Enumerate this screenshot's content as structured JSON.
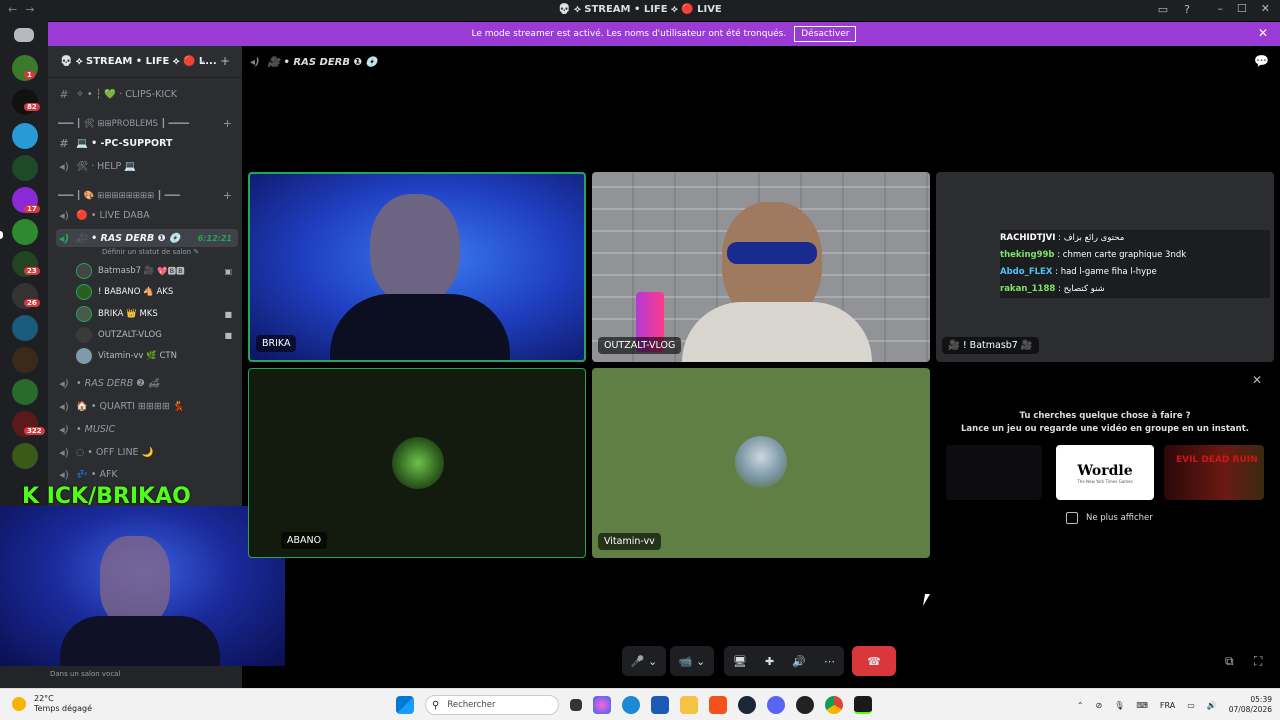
{
  "window": {
    "title": "💀 ⟡ STREAM • LIFE ⟡ 🔴 LIVE",
    "nav_back": "←",
    "nav_forward": "→",
    "minimize": "–",
    "maximize": "☐",
    "close": "✕",
    "inbox_icon": "▭",
    "help_icon": "?"
  },
  "banner": {
    "text": "Le mode streamer est activé. Les noms d'utilisateur ont été tronqués.",
    "button": "Désactiver",
    "close": "✕"
  },
  "rail": {
    "badges": [
      "1",
      "82",
      "17",
      "23",
      "26",
      "322"
    ]
  },
  "server": {
    "name": "💀 ⟡ STREAM • LIFE ⟡ 🔴 L...",
    "chevron": "⌄",
    "add_icon": "+"
  },
  "channels": {
    "clips": "✧ • ┆ 💚 · CLIPS-KICK",
    "cat_problems": "━━━ ┃ 🛠 ⊞⊞PROBLEMS ┃ ━━━━",
    "pc_support": "💻 • -PC-SUPPORT",
    "help": "🛠 · HELP 💻",
    "cat_voice": "━━━ ┃ 🎨 ⊞⊞⊞⊞⊞⊞⊞⊞ ┃ ━━━",
    "live_daba": "🔴 • LIVE DABA",
    "ras_derb": "🎥 • RAS DERB ❶ 💿",
    "ras_derb_time": "6:12:21",
    "status_placeholder": "Définir un statut de salon ✎",
    "users": [
      {
        "name": "Batmasb7 🎥",
        "tag": "💖🅱🅱"
      },
      {
        "name": "! BABANO",
        "tag": "🐴 AKS"
      },
      {
        "name": "BRIKA",
        "tag": "👑 MKS"
      },
      {
        "name": "OUTZALT-VLOG",
        "tag": ""
      },
      {
        "name": "Vitamin-vv",
        "tag": "🌿 CTN"
      }
    ],
    "ras_derb_2": "• RAS DERB ❷ 🛋",
    "quarti": "🏠 • QUARTI ⊞⊞⊞⊞ 💃",
    "music": "• MUSIC",
    "offline": "◌ • OFF LINE 🌙",
    "afk": "💤 • AFK"
  },
  "overlay": {
    "kick": "K ICK/BRIKAO",
    "status": "Dans un salon vocal"
  },
  "voice": {
    "header": "🎥 • RAS DERB ❶ 💿",
    "tiles": {
      "brika": "BRIKA",
      "outzalt": "OUTZALT-VLOG",
      "batmasb7": "🎥 ! Batmasb7 🎥",
      "babano": "ABANO",
      "vitamin": "Vitamin-vv"
    },
    "stream_chat": [
      {
        "user": "RACHIDTJVI",
        "color": "#ffffff",
        "msg": "محتوى رائع بزاف"
      },
      {
        "user": "theking99b",
        "color": "#7ee26a",
        "msg": "chmen carte graphique 3ndk"
      },
      {
        "user": "Abdo_FLEX",
        "color": "#4fc3f7",
        "msg": "had l-game fiha l-hype"
      },
      {
        "user": "rakan_1188",
        "color": "#7ee26a",
        "msg": "شنو كتصايح"
      }
    ]
  },
  "activity": {
    "line1": "Tu cherches quelque chose à faire ?",
    "line2": "Lance un jeu ou regarde une vidéo en groupe en un instant.",
    "wordle": "Wordle",
    "wordle_sub": "The New York Times Games",
    "evil_dead": "EVIL DEAD RUIN",
    "checkbox": "Ne plus afficher",
    "close": "✕"
  },
  "controls": {
    "mic": "🎤",
    "camera": "📹",
    "screen": "🖥",
    "activity": "✚",
    "soundboard": "🔊",
    "more": "⋯",
    "hangup": "☎"
  },
  "taskbar": {
    "temp": "22°C",
    "weather": "Temps dégagé",
    "search": "Rechercher",
    "lang": "FRA",
    "time": "05:39",
    "date": "07/08/2026"
  },
  "colors": {
    "banner": "#9b3bd6",
    "speaking": "#23a55a",
    "hangup": "#da373c",
    "kick": "#53fc18"
  }
}
